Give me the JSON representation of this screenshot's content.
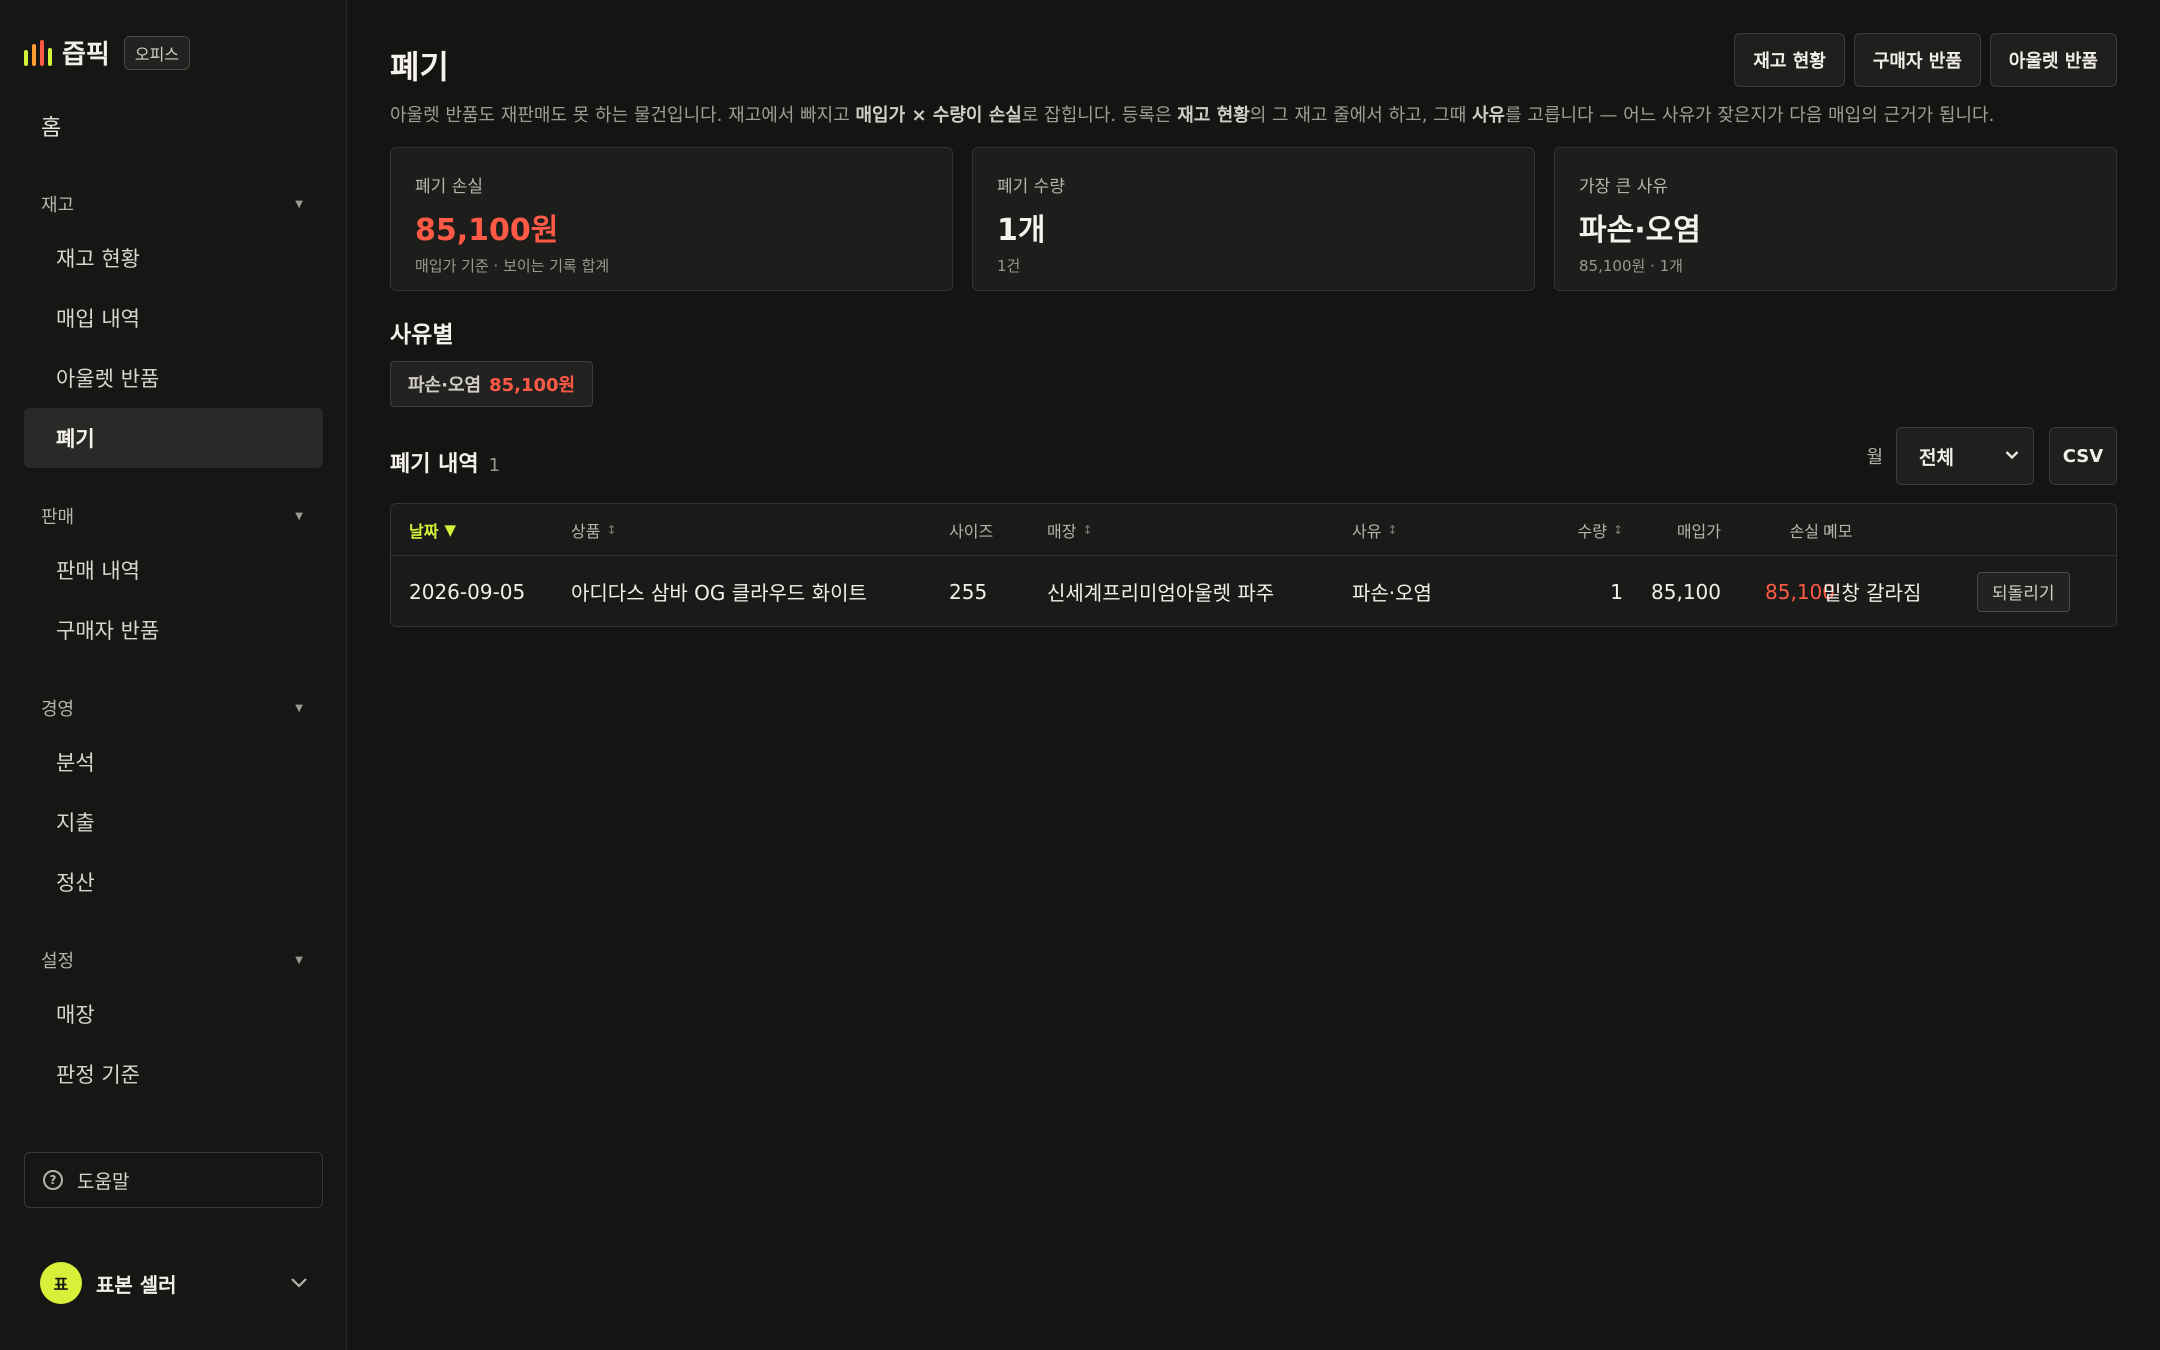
{
  "brand": {
    "name": "즙픽",
    "badge": "오피스",
    "icon_colors": [
      "#d7f03a",
      "#ff9a2e",
      "#ff5a45",
      "#d7f03a"
    ]
  },
  "sidebar": {
    "home": "홈",
    "sections": [
      {
        "label": "재고",
        "items": [
          "재고 현황",
          "매입 내역",
          "아울렛 반품",
          "폐기"
        ]
      },
      {
        "label": "판매",
        "items": [
          "판매 내역",
          "구매자 반품"
        ]
      },
      {
        "label": "경영",
        "items": [
          "분석",
          "지출",
          "정산"
        ]
      },
      {
        "label": "설정",
        "items": [
          "매장",
          "판정 기준"
        ]
      }
    ],
    "active_item": "폐기",
    "help": "도움말",
    "user": {
      "avatar": "표",
      "name": "표본 셀러"
    }
  },
  "page": {
    "title": "폐기",
    "actions": [
      "재고 현황",
      "구매자 반품",
      "아울렛 반품"
    ],
    "description": {
      "p1": "아울렛 반품도 재판매도 못 하는 물건입니다. 재고에서 빠지고 ",
      "b1": "매입가 × 수량이 손실",
      "p2": "로 잡힙니다. 등록은 ",
      "b2": "재고 현황",
      "p3": "의 그 재고 줄에서 하고, 그때 ",
      "b3": "사유",
      "p4": "를 고릅니다 — 어느 사유가 잦은지가 다음 매입의 근거가 됩니다."
    }
  },
  "cards": [
    {
      "label": "폐기 손실",
      "value": "85,100원",
      "sub": "매입가 기준 · 보이는 기록 합계"
    },
    {
      "label": "폐기 수량",
      "value": "1개",
      "sub": "1건"
    },
    {
      "label": "가장 큰 사유",
      "value": "파손·오염",
      "sub": "85,100원 · 1개"
    }
  ],
  "by_reason": {
    "title": "사유별",
    "chips": [
      {
        "label": "파손·오염",
        "amount": "85,100원"
      }
    ]
  },
  "list": {
    "title": "폐기 내역",
    "count": "1",
    "filter_label": "월",
    "filter_value": "전체",
    "csv": "CSV",
    "columns": [
      "날짜",
      "상품",
      "사이즈",
      "매장",
      "사유",
      "수량",
      "매입가",
      "손실",
      "메모"
    ],
    "sort_indicator": "▼",
    "rows": [
      {
        "date": "2026-09-05",
        "product": "아디다스 삼바 OG 클라우드 화이트",
        "size": "255",
        "store": "신세계프리미엄아울렛 파주",
        "reason": "파손·오염",
        "qty": "1",
        "cost": "85,100",
        "loss": "85,100",
        "memo": "밑창 갈라짐",
        "action": "되돌리기"
      }
    ]
  },
  "colors": {
    "accent": "#d7f03a",
    "loss": "#ff5a45",
    "background": "#141412"
  }
}
